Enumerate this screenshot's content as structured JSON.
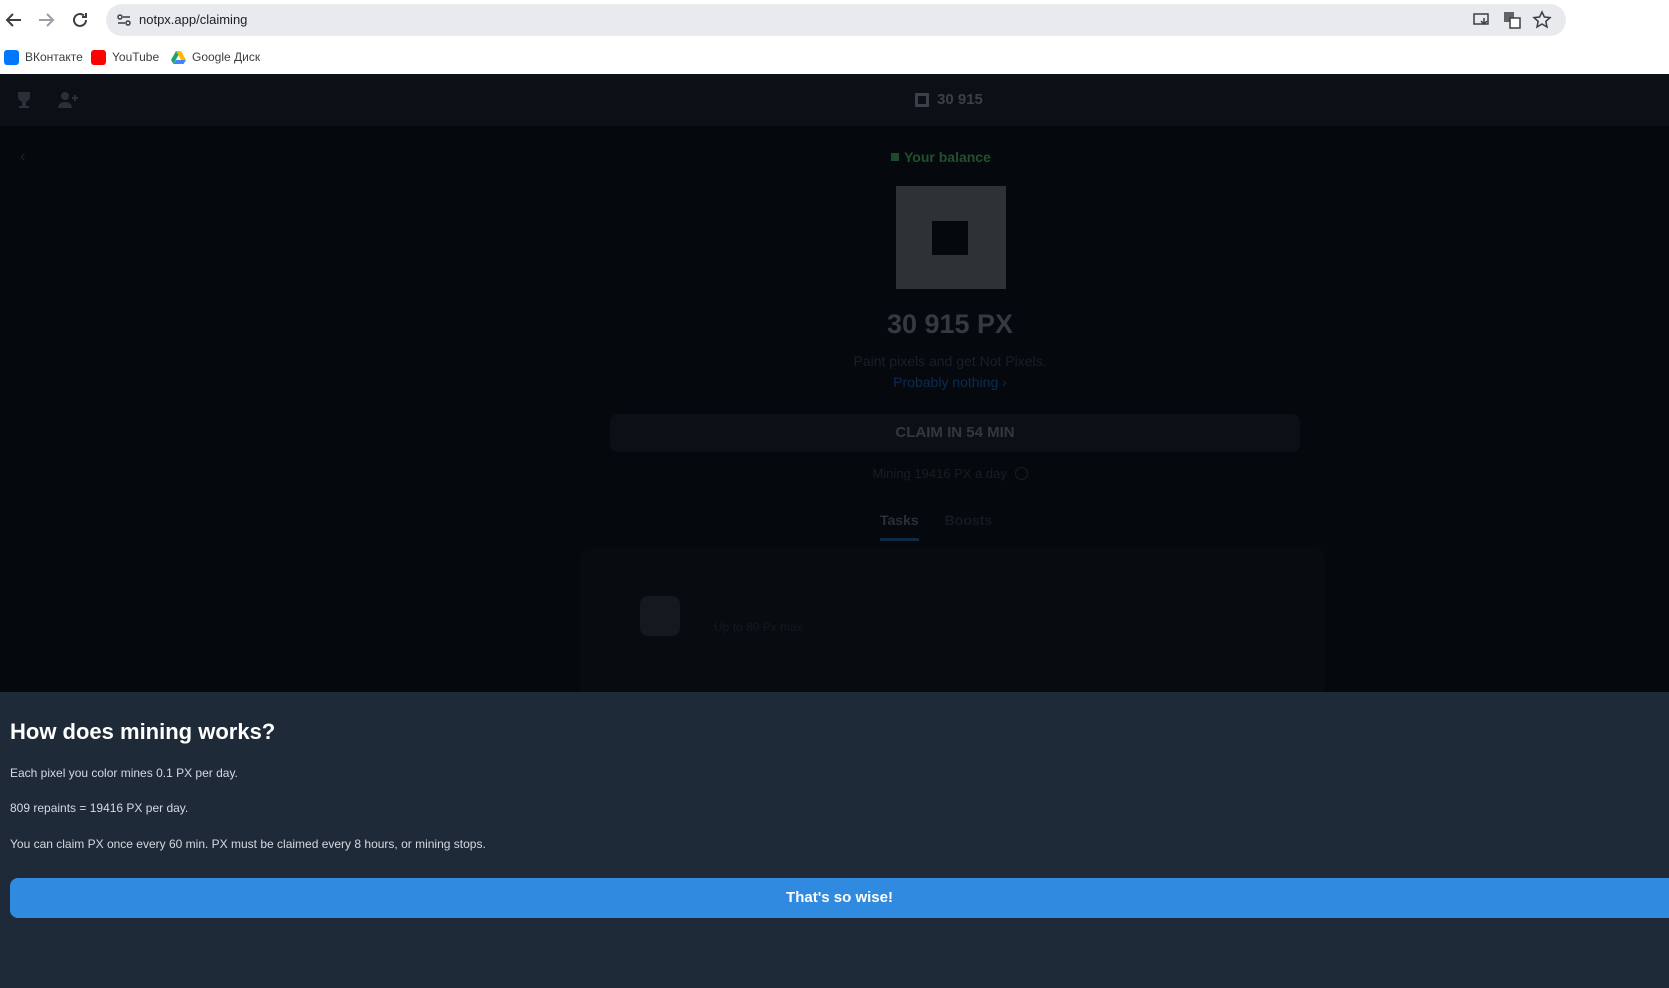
{
  "browser": {
    "url": "notpx.app/claiming",
    "bookmarks": [
      {
        "label": "ВКонтакте",
        "icon": "vk-icon",
        "color": "#0077ff"
      },
      {
        "label": "YouTube",
        "icon": "youtube-icon",
        "color": "#ff0000"
      },
      {
        "label": "Google Диск",
        "icon": "google-drive-icon",
        "color": "#1fa463"
      }
    ]
  },
  "app": {
    "header_balance": "30 915",
    "your_balance_label": "Your balance",
    "balance": "30 915 PX",
    "subtitle": "Paint pixels and get Not Pixels.",
    "link": "Probably nothing",
    "claim_label": "CLAIM IN 54 MIN",
    "mining_rate": "Mining 19416 PX a day",
    "tabs": [
      "Tasks",
      "Boosts"
    ],
    "task_reward": "Up to  80 Px max"
  },
  "sheet": {
    "title": "How does mining works?",
    "line1": "Each pixel you color mines 0.1 PX per day.",
    "line2": "809 repaints = 19416 PX per day.",
    "line3": "You can claim PX once every 60 min. PX must be claimed every 8 hours, or mining stops.",
    "button": "That's so wise!"
  },
  "colors": {
    "accent": "#2f8ae0",
    "sheet_bg": "#1f2a39",
    "overlay_bg": "#05080c"
  }
}
